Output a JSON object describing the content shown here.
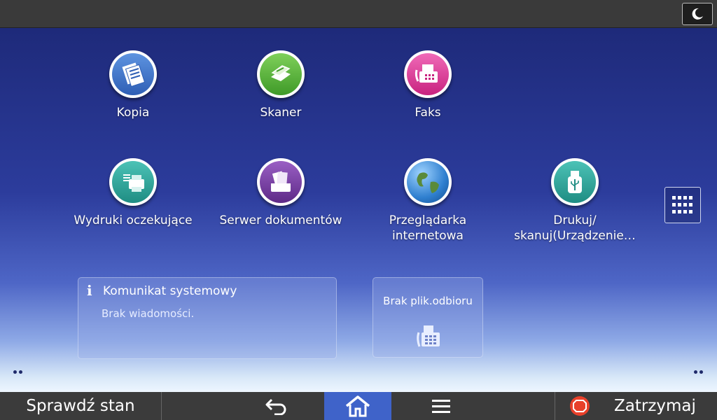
{
  "apps": [
    {
      "id": "copy",
      "label": "Kopia",
      "icon": "copy-icon",
      "color": "#3f73c8"
    },
    {
      "id": "scanner",
      "label": "Skaner",
      "icon": "scanner-icon",
      "color": "#5cb43c"
    },
    {
      "id": "fax",
      "label": "Faks",
      "icon": "fax-icon",
      "color": "#e0399a"
    },
    {
      "id": "held-prints",
      "label": "Wydruki oczekujące",
      "icon": "printer-icon",
      "color": "#27a59a"
    },
    {
      "id": "document-server",
      "label": "Serwer dokumentów",
      "icon": "document-server-icon",
      "color": "#7a3fa6"
    },
    {
      "id": "web-browser",
      "label": "Przeglądarka\ninternetowa",
      "icon": "globe-icon",
      "color": "#2f7fcf"
    },
    {
      "id": "print-scan-device",
      "label": "Drukuj/\nskanuj(Urządzenie…",
      "icon": "usb-icon",
      "color": "#27a59a"
    }
  ],
  "system_message": {
    "title": "Komunikat systemowy",
    "body": "Brak wiadomości.",
    "icon": "info-icon"
  },
  "fax_widget": {
    "title": "Brak plik.odbioru",
    "icon": "fax-machine-icon"
  },
  "bottom_bar": {
    "status_label": "Sprawdź stan",
    "stop_label": "Zatrzymaj"
  },
  "colors": {
    "home_active": "#3f63c9",
    "stop": "#e8402a"
  }
}
